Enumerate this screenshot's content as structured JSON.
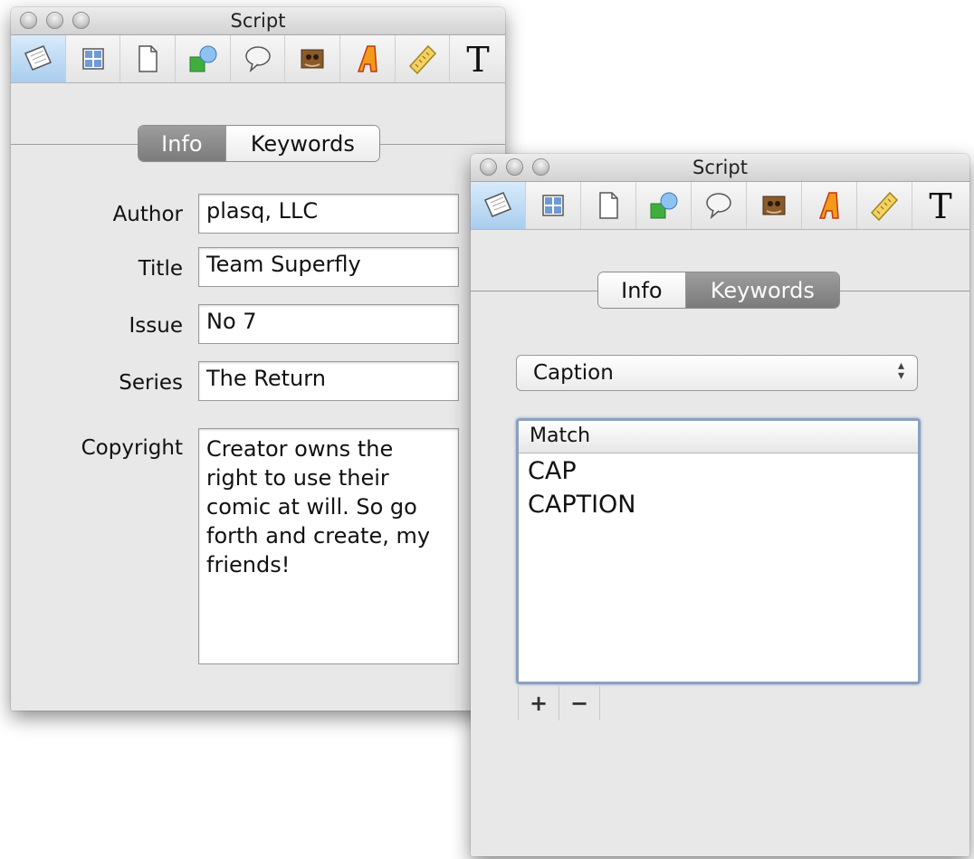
{
  "window_back": {
    "title": "Script",
    "tabs": {
      "info": "Info",
      "keywords": "Keywords"
    },
    "fields": {
      "author": {
        "label": "Author",
        "value": "plasq, LLC"
      },
      "title": {
        "label": "Title",
        "value": "Team Superfly"
      },
      "issue": {
        "label": "Issue",
        "value": "No 7"
      },
      "series": {
        "label": "Series",
        "value": "The Return"
      },
      "copyright": {
        "label": "Copyright",
        "value": "Creator owns the\nright to use their\ncomic at will. So go\nforth and create, my\nfriends!"
      }
    }
  },
  "window_front": {
    "title": "Script",
    "tabs": {
      "info": "Info",
      "keywords": "Keywords"
    },
    "style_popup": "Caption",
    "table": {
      "header": "Match",
      "rows": [
        "CAP",
        "CAPTION"
      ]
    },
    "buttons": {
      "add": "+",
      "remove": "−"
    }
  },
  "toolbar_icons": [
    "script-icon",
    "layout-icon",
    "page-icon",
    "shapes-icon",
    "balloon-icon",
    "photo-icon",
    "lettering-icon",
    "ruler-icon",
    "text-icon"
  ],
  "colors": {
    "active_tab": "#8a8a8a",
    "selected_tool": "#a9cdee",
    "table_focus": "#8aa0bf"
  }
}
